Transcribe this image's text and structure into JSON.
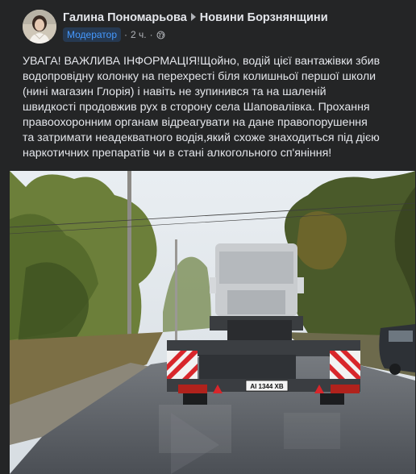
{
  "post": {
    "author": "Галина Пономарьова",
    "group": "Новини Борзнянщини",
    "role_badge": "Модератор",
    "time": "2 ч.",
    "separator": "·",
    "text_lines": [
      "УВАГА! ВАЖЛИВА ІНФОРМАЦІЯ!Щойно, водій цієї вантажівки збив",
      "водопровідну колонку на перехресті біля колишньої першої школи",
      "(нині магазин Глорія) і навіть не зупинився та на шаленій",
      "швидкості продовжив рух в сторону села Шаповалівка. Прохання",
      "правоохоронним органам відреагувати на дане правопорушення",
      "та затримати неадекватного водія,який схоже знаходиться під дією",
      "наркотичних препаратів чи в стані алкогольного сп'яніння!"
    ],
    "photo": {
      "plate": "АІ 1344 ХВ"
    }
  },
  "icons": {
    "audience": "globe-icon",
    "arrow": "triangle-right-icon"
  },
  "colors": {
    "background": "#242526",
    "text": "#e4e6eb",
    "secondary_text": "#b0b3b8",
    "badge_bg": "#263951",
    "badge_text": "#4599ff"
  }
}
